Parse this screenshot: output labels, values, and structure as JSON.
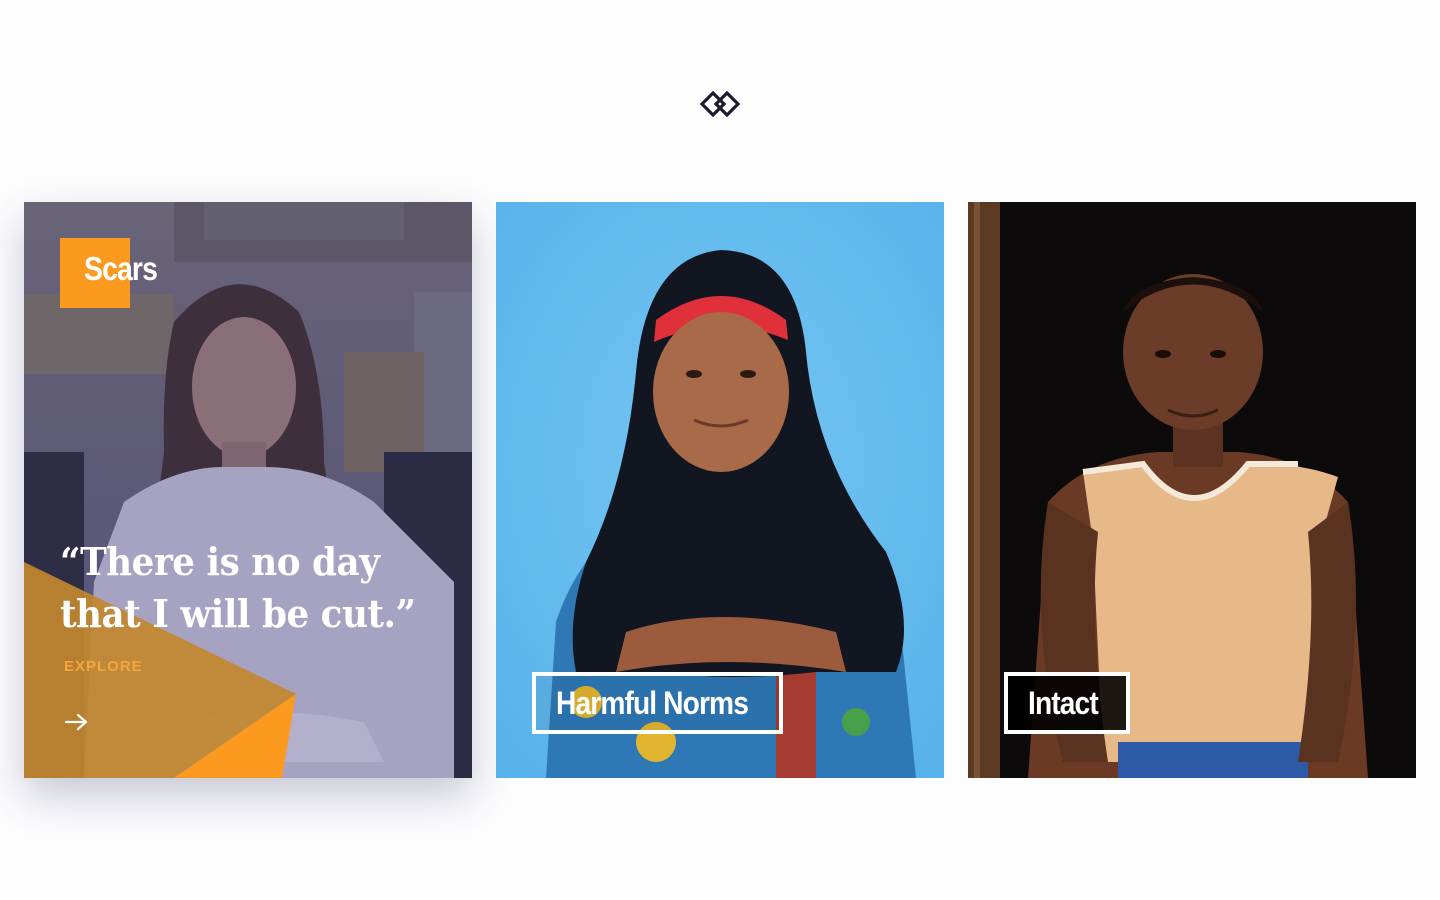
{
  "logo": {
    "icon": "interlocking-diamonds-icon"
  },
  "cards": [
    {
      "tag": "Scars",
      "quote": "“There is no day that I will be cut.”",
      "cta": "EXPLORE",
      "cta_icon": "arrow-right-icon",
      "accent": "#fb9a1f",
      "overlay": "#4a4a8a"
    },
    {
      "label": "Harmful Norms",
      "background": "#5fb8ee"
    },
    {
      "label": "Intact",
      "background": "#0d0b0b"
    }
  ]
}
